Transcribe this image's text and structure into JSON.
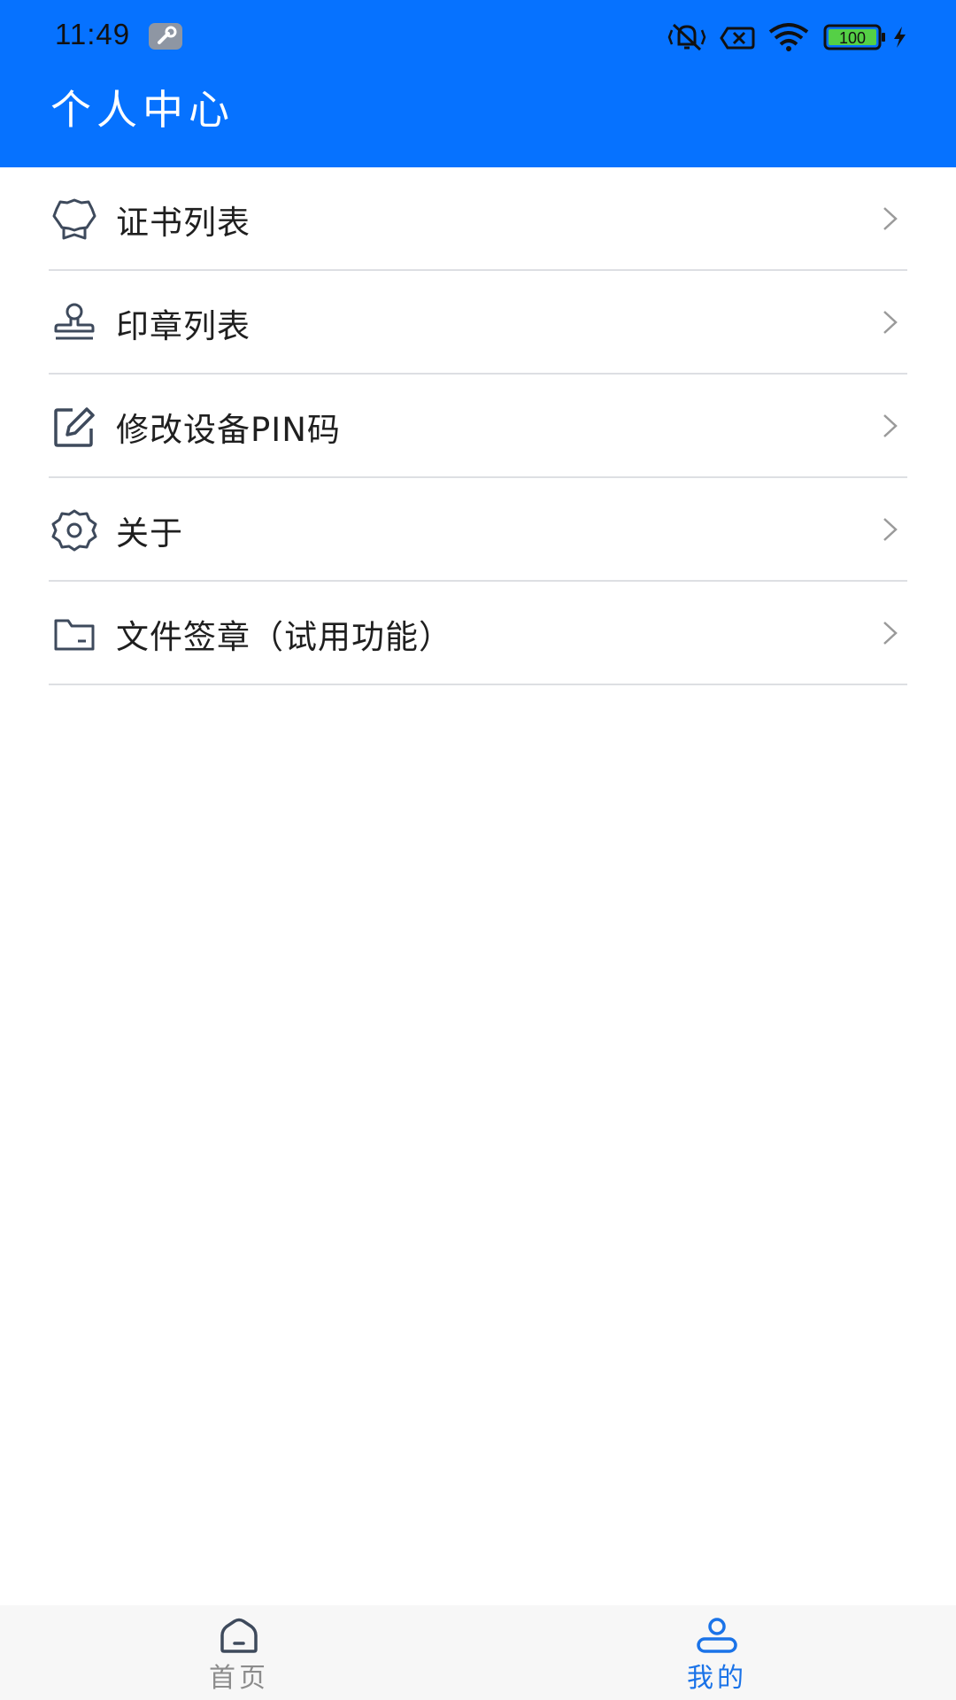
{
  "status_bar": {
    "time": "11:49",
    "battery": "100",
    "icons": [
      "wrench-icon",
      "vibrate-icon",
      "no-sim-icon",
      "wifi-icon",
      "battery-icon",
      "charging-icon"
    ]
  },
  "header": {
    "title": "个人中心",
    "background": "#0672FF"
  },
  "menu": {
    "items": [
      {
        "label": "证书列表",
        "icon": "certificate-icon"
      },
      {
        "label": "印章列表",
        "icon": "stamp-icon"
      },
      {
        "label": "修改设备PIN码",
        "icon": "edit-icon"
      },
      {
        "label": "关于",
        "icon": "settings-gear-icon"
      },
      {
        "label": "文件签章（试用功能）",
        "icon": "folder-icon"
      }
    ]
  },
  "tabbar": {
    "tabs": [
      {
        "label": "首页",
        "icon": "home-icon",
        "active": false
      },
      {
        "label": "我的",
        "icon": "user-icon",
        "active": true
      }
    ],
    "active_color": "#1A73E8",
    "inactive_color": "#8C8C8C"
  }
}
